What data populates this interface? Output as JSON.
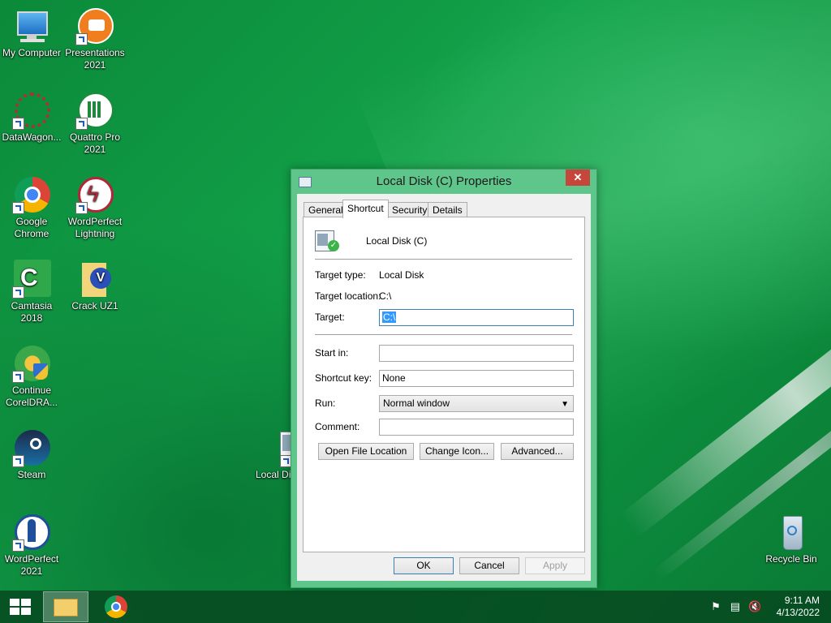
{
  "desktop": {
    "icons": [
      {
        "label": "My Computer"
      },
      {
        "label": "Presentations 2021"
      },
      {
        "label": "DataWagon..."
      },
      {
        "label": "Quattro Pro 2021"
      },
      {
        "label": "Google Chrome"
      },
      {
        "label": "WordPerfect Lightning"
      },
      {
        "label": "Camtasia 2018"
      },
      {
        "label": "Crack UZ1"
      },
      {
        "label": "Continue CorelDRA..."
      },
      {
        "label": "Steam"
      },
      {
        "label": "WordPerfect 2021"
      },
      {
        "label": "Local Di"
      },
      {
        "label": "Recycle Bin"
      }
    ]
  },
  "dialog": {
    "title": "Local Disk (C) Properties",
    "close_label": "✕",
    "tabs": [
      {
        "label": "General"
      },
      {
        "label": "Shortcut"
      },
      {
        "label": "Security"
      },
      {
        "label": "Details"
      }
    ],
    "active_tab": "Shortcut",
    "name": "Local Disk (C)",
    "target_type_label": "Target type:",
    "target_type_value": "Local Disk",
    "target_location_label": "Target location:",
    "target_location_value": "C:\\",
    "target_label": "Target:",
    "target_value": "C:\\",
    "start_in_label": "Start in:",
    "start_in_value": "",
    "shortcut_key_label": "Shortcut key:",
    "shortcut_key_value": "None",
    "run_label": "Run:",
    "run_value": "Normal window",
    "comment_label": "Comment:",
    "comment_value": "",
    "buttons": {
      "open_file_location": "Open File Location",
      "change_icon": "Change Icon...",
      "advanced": "Advanced...",
      "ok": "OK",
      "cancel": "Cancel",
      "apply": "Apply"
    }
  },
  "taskbar": {
    "time": "9:11 AM",
    "date": "4/13/2022"
  },
  "colors": {
    "wallpaper": "#0e8a3e",
    "dialog_frame": "#5fc68b",
    "close_button": "#c7463c",
    "selection": "#3399ff"
  }
}
